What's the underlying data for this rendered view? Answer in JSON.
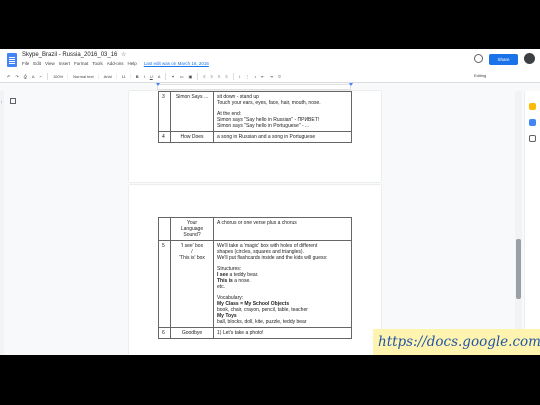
{
  "titlebar": {
    "doc_title": "Skype_Brazil - Russia_2016_03_16",
    "star": "☆",
    "menu": [
      "File",
      "Edit",
      "View",
      "Insert",
      "Format",
      "Tools",
      "Add-ons",
      "Help"
    ],
    "last_edit": "Last edit was on March 16, 2016",
    "share_label": "Share"
  },
  "toolbar": {
    "zoom": "100%",
    "style": "Normal text",
    "font": "Arial",
    "size": "11",
    "mode": "Editing"
  },
  "page1": {
    "rows": [
      {
        "num": "3",
        "activity": "Simon Says ...",
        "desc1": [
          "sit down - stand up",
          "Touch your ears, eyes, face, hair, mouth, nose."
        ],
        "desc2": [
          "At the end:",
          "Simon says \"Say hello in Russian\" - ПРИВЕТ!",
          "Simon says \"Say hello in Portuguese\" - ..."
        ]
      },
      {
        "num": "4",
        "activity": "How Does",
        "desc": "a song in Russian and a song in Portuguese"
      }
    ]
  },
  "page2": {
    "row_top": {
      "activity": [
        "Your",
        "Language",
        "Sound?"
      ],
      "desc": "A chorus or one verse plus a chorus"
    },
    "row5": {
      "num": "5",
      "activity": [
        "'I see' box",
        "/",
        "'This is' box"
      ],
      "intro": [
        "We'll take a 'magic' box with holes of different",
        "shapes (circles, squares and triangles).",
        "We'll put flashcards inside and the kids will guess:"
      ],
      "structures_label": "Structures:",
      "s1_bold": "I see",
      "s1_rest": " a teddy bear.",
      "s2_bold": "This is",
      "s2_rest": " a nose.",
      "etc": "etc.",
      "vocab_label": "Vocabulary:",
      "vocab_class": "My Class = My School Objects",
      "vocab_class_items": "book, chair, crayon, pencil, table, teacher",
      "vocab_toys": "My Toys",
      "vocab_toys_items": "ball, blocks, doll, kite, puzzle, teddy bear"
    },
    "row6": {
      "num": "6",
      "activity": "Goodbye",
      "desc": "1) Let's take a photo!"
    }
  },
  "watermark": "https://docs.google.com",
  "colors": {
    "accent": "#1a73e8",
    "watermark_bg": "#fff3b0"
  }
}
